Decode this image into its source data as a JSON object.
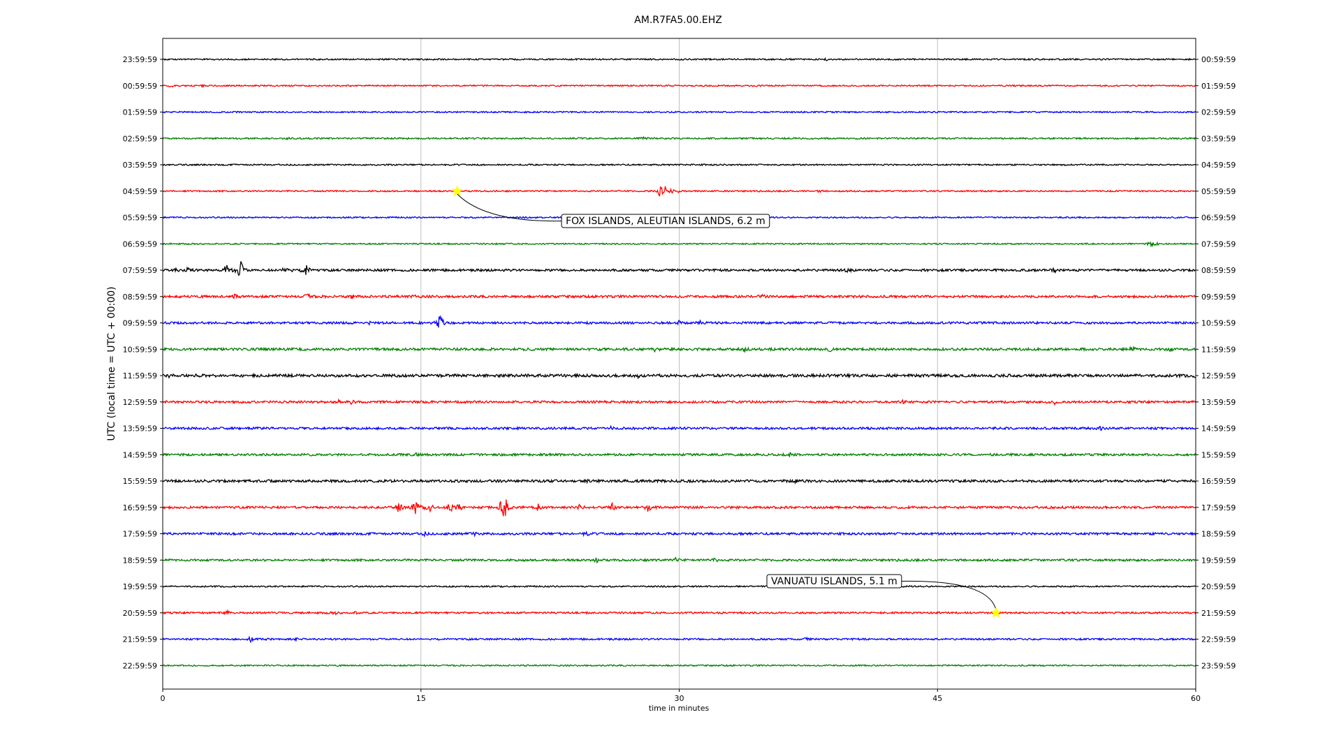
{
  "chart_data": {
    "type": "line",
    "title": "AM.R7FA5.00.EHZ",
    "xlabel": "time in minutes",
    "ylabel": "UTC (local time = UTC + 00:00)",
    "xlim": [
      0,
      60
    ],
    "xticks": [
      0,
      15,
      30,
      45,
      60
    ],
    "grid": "vertical",
    "colors": [
      "#000000",
      "#ff0000",
      "#0000ff",
      "#008000"
    ],
    "rows": [
      {
        "left": "23:59:59",
        "right": "00:59:59",
        "color": "#000000",
        "noise": 1.0,
        "bursts": [
          [
            38.6,
            1.6
          ]
        ]
      },
      {
        "left": "00:59:59",
        "right": "01:59:59",
        "color": "#ff0000",
        "noise": 1.0,
        "bursts": [
          [
            0.5,
            1.8
          ],
          [
            2.3,
            1.2
          ]
        ]
      },
      {
        "left": "01:59:59",
        "right": "02:59:59",
        "color": "#0000ff",
        "noise": 1.0,
        "bursts": []
      },
      {
        "left": "02:59:59",
        "right": "03:59:59",
        "color": "#008000",
        "noise": 1.1,
        "bursts": [
          [
            28.0,
            2.0
          ],
          [
            7.2,
            1.4
          ]
        ]
      },
      {
        "left": "03:59:59",
        "right": "04:59:59",
        "color": "#000000",
        "noise": 1.0,
        "bursts": []
      },
      {
        "left": "04:59:59",
        "right": "05:59:59",
        "color": "#ff0000",
        "noise": 1.0,
        "bursts": [
          [
            28.9,
            10.0
          ],
          [
            29.2,
            6.0
          ],
          [
            29.6,
            3.0
          ],
          [
            30.0,
            2.0
          ],
          [
            38.1,
            1.3
          ]
        ]
      },
      {
        "left": "05:59:59",
        "right": "06:59:59",
        "color": "#0000ff",
        "noise": 1.0,
        "bursts": []
      },
      {
        "left": "06:59:59",
        "right": "07:59:59",
        "color": "#008000",
        "noise": 1.0,
        "bursts": [
          [
            57.4,
            4.0
          ],
          [
            57.8,
            2.0
          ]
        ]
      },
      {
        "left": "07:59:59",
        "right": "08:59:59",
        "color": "#000000",
        "noise": 1.6,
        "bursts": [
          [
            0.7,
            3.0
          ],
          [
            1.5,
            4.0
          ],
          [
            3.7,
            11.0
          ],
          [
            4.5,
            18.0
          ],
          [
            7.2,
            12.0
          ],
          [
            8.3,
            11.0
          ],
          [
            39.8,
            3.0
          ],
          [
            51.8,
            3.0
          ]
        ]
      },
      {
        "left": "08:59:59",
        "right": "09:59:59",
        "color": "#ff0000",
        "noise": 1.7,
        "bursts": [
          [
            4.2,
            3.0
          ],
          [
            8.4,
            4.0
          ],
          [
            11.0,
            3.0
          ],
          [
            14.7,
            2.5
          ],
          [
            34.8,
            2.5
          ]
        ]
      },
      {
        "left": "09:59:59",
        "right": "10:59:59",
        "color": "#0000ff",
        "noise": 1.6,
        "bursts": [
          [
            16.1,
            20.0
          ],
          [
            12.0,
            2.0
          ],
          [
            30.0,
            2.5
          ],
          [
            31.2,
            2.0
          ]
        ]
      },
      {
        "left": "10:59:59",
        "right": "11:59:59",
        "color": "#008000",
        "noise": 1.8,
        "bursts": [
          [
            28.6,
            3.0
          ],
          [
            33.8,
            3.0
          ],
          [
            38.8,
            3.0
          ],
          [
            56.3,
            3.0
          ],
          [
            58.5,
            2.0
          ]
        ]
      },
      {
        "left": "11:59:59",
        "right": "12:59:59",
        "color": "#000000",
        "noise": 2.0,
        "bursts": [
          [
            0.3,
            2.5
          ],
          [
            2.2,
            2.0
          ],
          [
            27.6,
            2.0
          ],
          [
            60.0,
            2.0
          ]
        ]
      },
      {
        "left": "12:59:59",
        "right": "13:59:59",
        "color": "#ff0000",
        "noise": 1.6,
        "bursts": [
          [
            11.0,
            3.0
          ],
          [
            10.2,
            2.5
          ],
          [
            51.8,
            2.5
          ],
          [
            43.0,
            2.0
          ]
        ]
      },
      {
        "left": "13:59:59",
        "right": "14:59:59",
        "color": "#0000ff",
        "noise": 1.6,
        "bursts": [
          [
            26.0,
            2.0
          ],
          [
            54.5,
            2.5
          ]
        ]
      },
      {
        "left": "14:59:59",
        "right": "15:59:59",
        "color": "#008000",
        "noise": 1.6,
        "bursts": [
          [
            14.7,
            2.0
          ],
          [
            36.4,
            2.0
          ]
        ]
      },
      {
        "left": "15:59:59",
        "right": "16:59:59",
        "color": "#000000",
        "noise": 1.8,
        "bursts": [
          [
            24.7,
            2.5
          ],
          [
            36.8,
            2.0
          ]
        ]
      },
      {
        "left": "16:59:59",
        "right": "17:59:59",
        "color": "#ff0000",
        "noise": 1.6,
        "bursts": [
          [
            13.7,
            9.0
          ],
          [
            14.7,
            11.0
          ],
          [
            15.5,
            13.0
          ],
          [
            16.7,
            7.0
          ],
          [
            17.2,
            6.0
          ],
          [
            19.7,
            14.0
          ],
          [
            19.9,
            20.0
          ],
          [
            21.8,
            5.0
          ],
          [
            24.2,
            5.0
          ],
          [
            26.1,
            6.0
          ],
          [
            28.2,
            6.0
          ]
        ]
      },
      {
        "left": "17:59:59",
        "right": "18:59:59",
        "color": "#0000ff",
        "noise": 1.6,
        "bursts": [
          [
            15.2,
            3.0
          ],
          [
            24.6,
            3.0
          ],
          [
            18.1,
            2.0
          ]
        ]
      },
      {
        "left": "18:59:59",
        "right": "19:59:59",
        "color": "#008000",
        "noise": 1.5,
        "bursts": [
          [
            25.2,
            2.5
          ],
          [
            29.8,
            2.5
          ],
          [
            32.1,
            2.5
          ]
        ]
      },
      {
        "left": "19:59:59",
        "right": "20:59:59",
        "color": "#000000",
        "noise": 1.0,
        "bursts": []
      },
      {
        "left": "20:59:59",
        "right": "21:59:59",
        "color": "#ff0000",
        "noise": 1.3,
        "bursts": [
          [
            3.7,
            3.0
          ],
          [
            11.3,
            2.5
          ],
          [
            10.0,
            2.0
          ]
        ]
      },
      {
        "left": "21:59:59",
        "right": "22:59:59",
        "color": "#0000ff",
        "noise": 1.2,
        "bursts": [
          [
            5.1,
            3.5
          ],
          [
            6.0,
            3.0
          ],
          [
            7.8,
            2.5
          ],
          [
            37.4,
            2.0
          ]
        ]
      },
      {
        "left": "22:59:59",
        "right": "23:59:59",
        "color": "#008000",
        "noise": 1.0,
        "bursts": []
      }
    ],
    "annotations": [
      {
        "text": "FOX ISLANDS, ALEUTIAN ISLANDS, 6.2 m",
        "x": 17.1,
        "row": 5,
        "marker": "star",
        "marker_color": "#ffff00"
      },
      {
        "text": "VANUATU ISLANDS, 5.1 m",
        "x": 48.4,
        "row": 21,
        "marker": "star",
        "marker_color": "#ffff00"
      }
    ]
  }
}
